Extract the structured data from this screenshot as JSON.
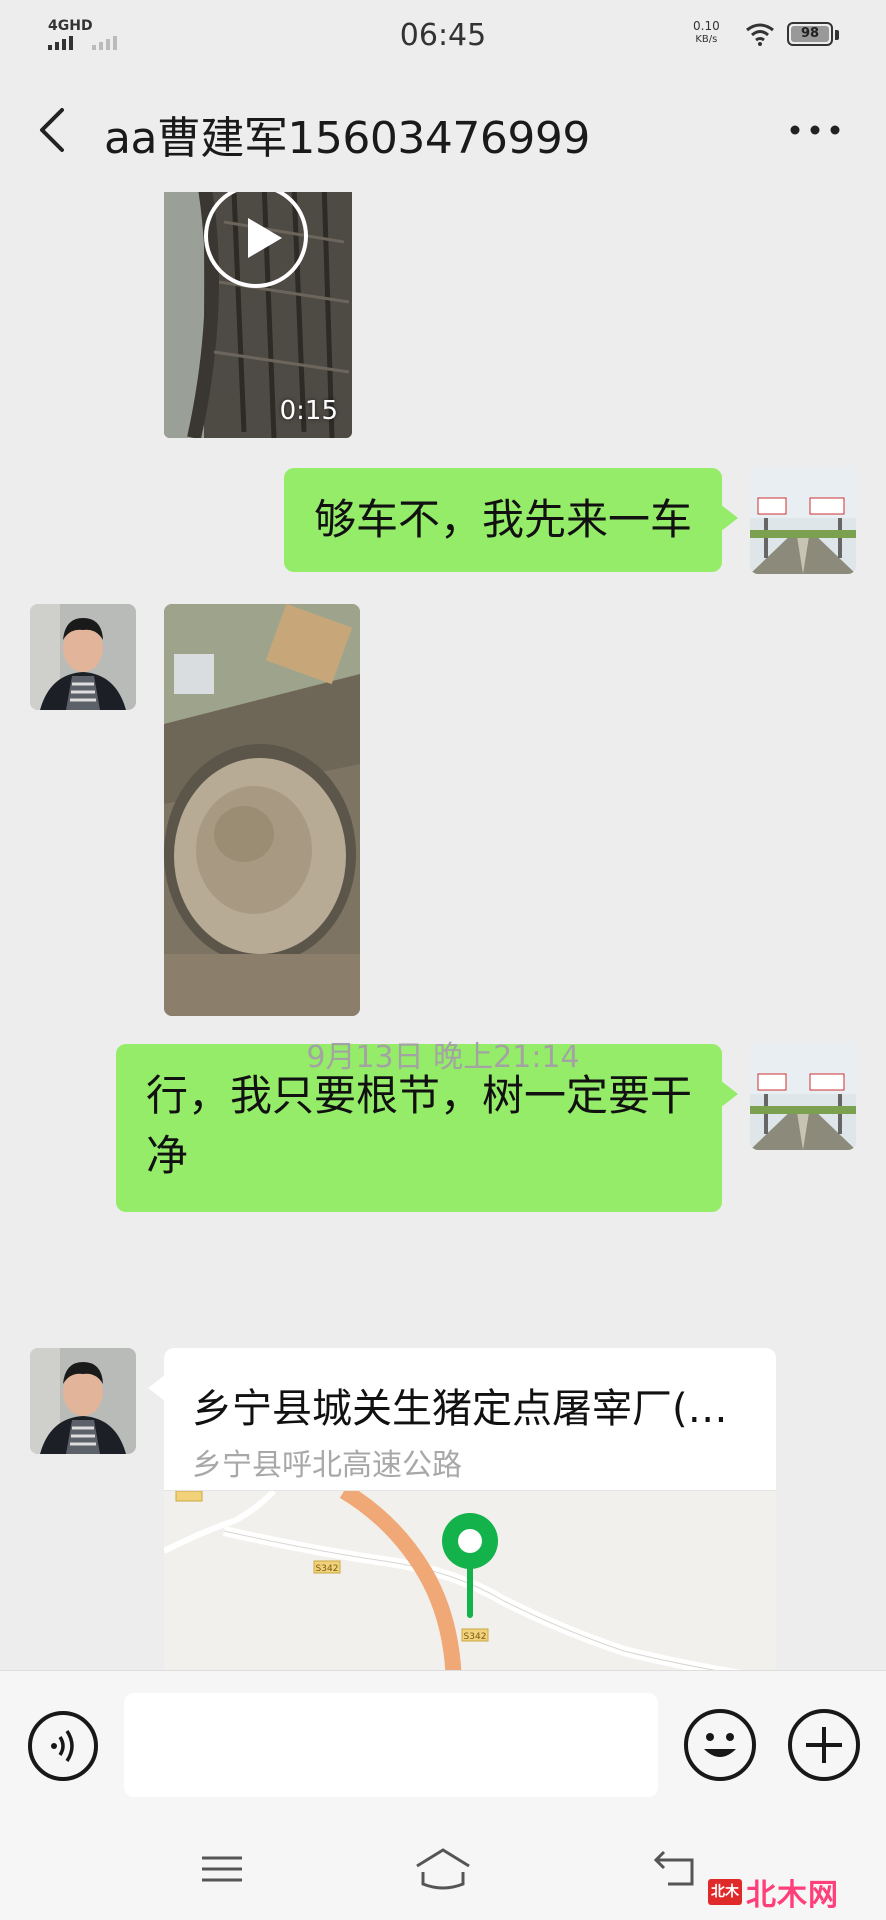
{
  "status_bar": {
    "network_label": "4GHD",
    "time": "06:45",
    "speed_value": "0.10",
    "speed_unit": "KB/s",
    "battery": "98"
  },
  "nav": {
    "title": "aa曹建军15603476999",
    "back_icon": "chevron-left-icon",
    "more_icon": "more-dots-icon"
  },
  "messages": [
    {
      "type": "video",
      "direction": "incoming",
      "duration": "0:15"
    },
    {
      "type": "text",
      "direction": "outgoing",
      "text": "够车不，我先来一车"
    },
    {
      "type": "image",
      "direction": "incoming"
    },
    {
      "type": "text",
      "direction": "outgoing",
      "text": "行，我只要根节，树一定要干净"
    },
    {
      "type": "timestamp",
      "text": "9月13日 晚上21:14"
    },
    {
      "type": "location",
      "direction": "incoming",
      "title": "乡宁县城关生猪定点屠宰厂(…",
      "address": "乡宁县呼北高速公路",
      "map_labels": [
        "S342",
        "S342"
      ]
    }
  ],
  "input_bar": {
    "voice_icon": "voice-icon",
    "emoji_icon": "emoji-icon",
    "plus_icon": "plus-icon"
  },
  "system_nav": {
    "menu_icon": "menu-icon",
    "home_icon": "home-icon",
    "back_icon": "back-arrow-icon"
  },
  "watermark": {
    "logo_text": "北木",
    "text": "北木网"
  }
}
